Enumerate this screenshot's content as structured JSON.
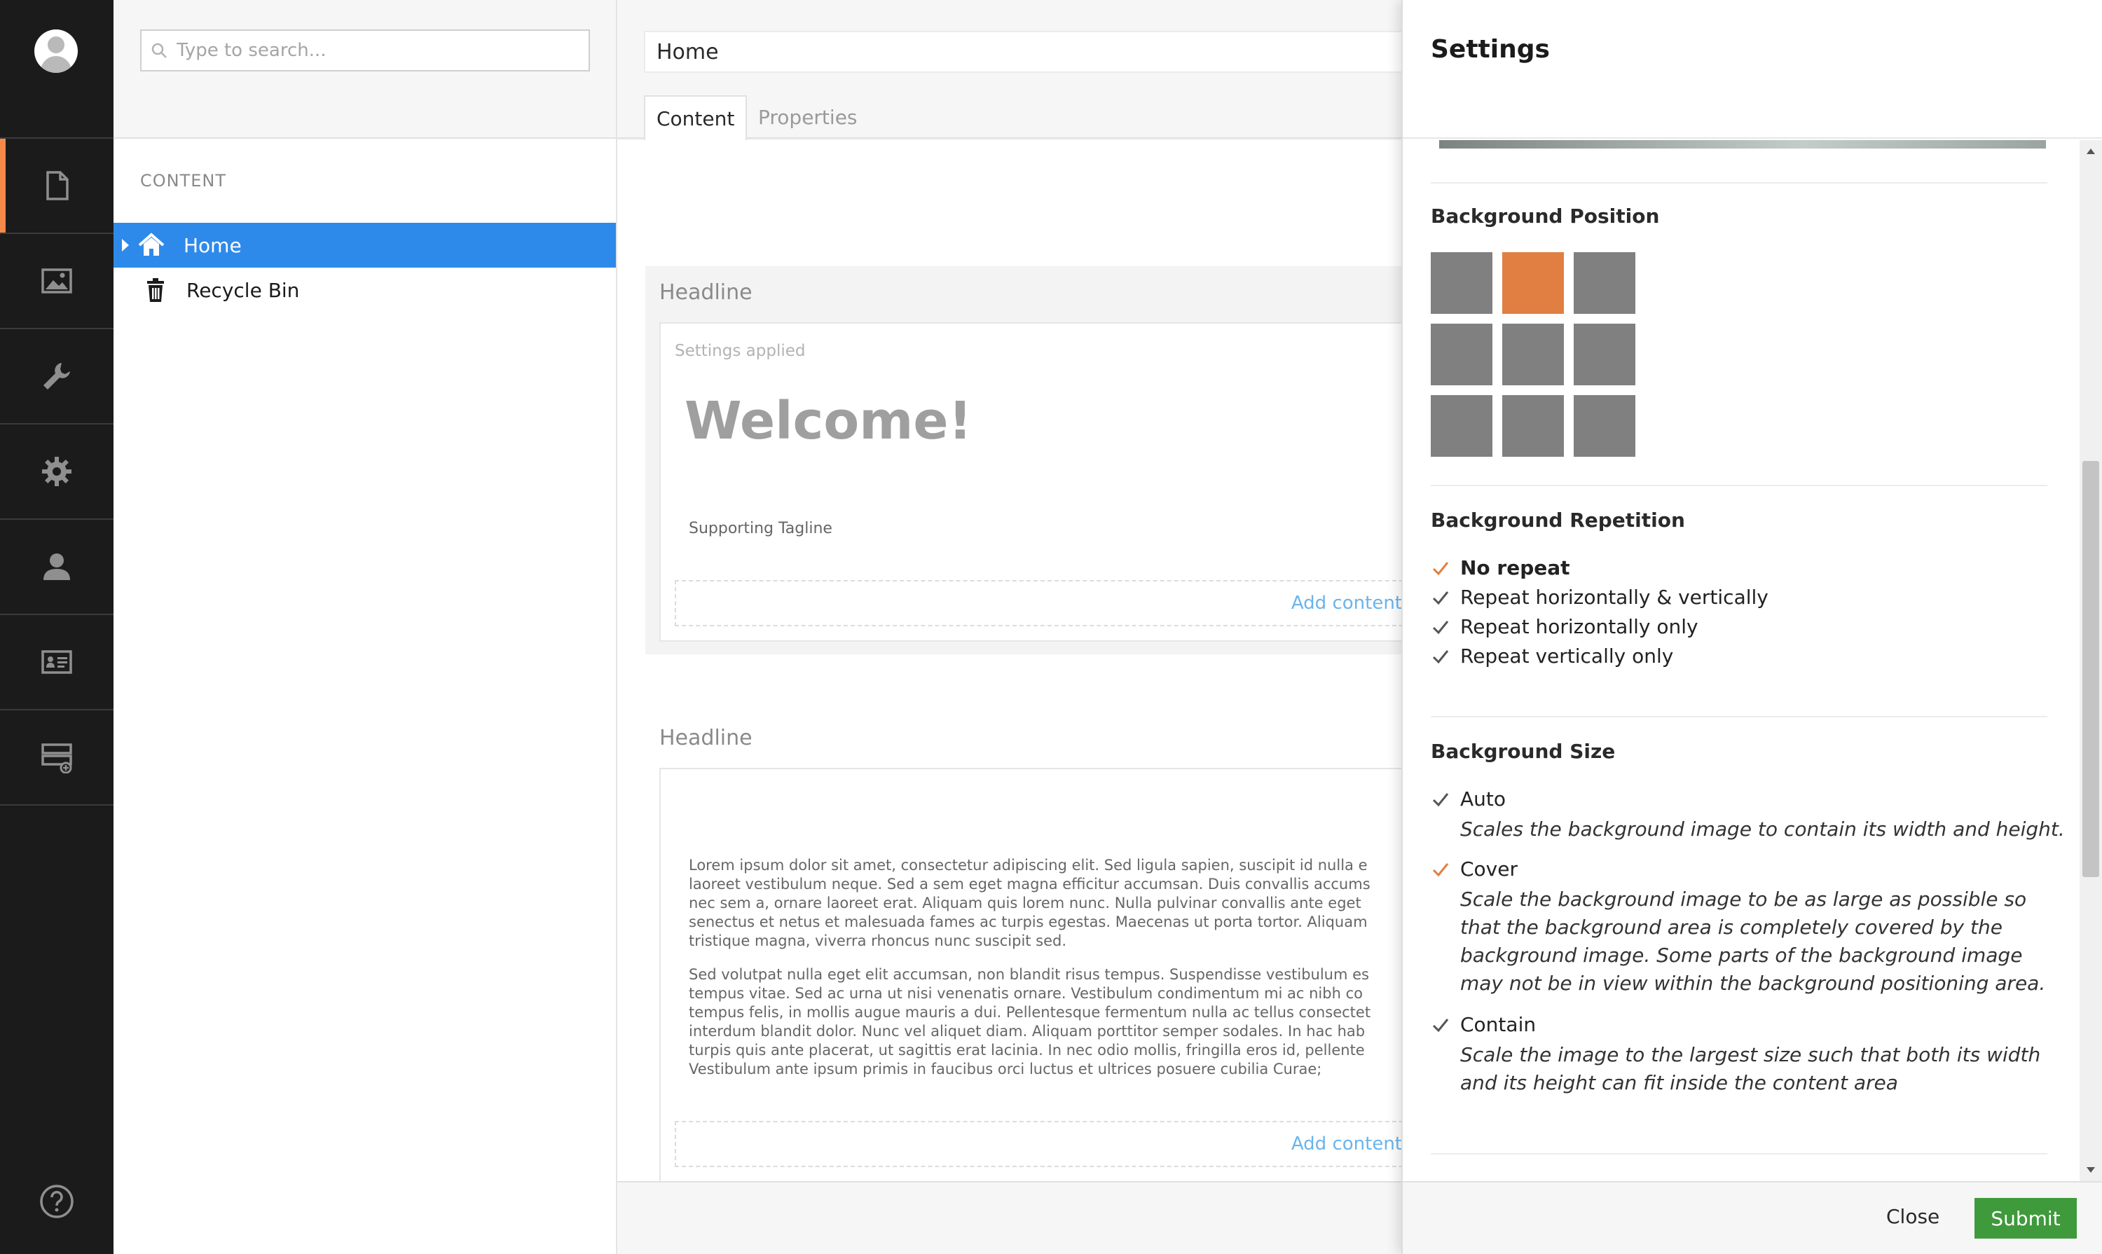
{
  "app": {
    "search": {
      "placeholder": "Type to search..."
    },
    "sections": [
      "content-icon",
      "media-icon",
      "settings-wrench-icon",
      "gear-icon",
      "users-icon",
      "members-icon",
      "forms-icon"
    ],
    "help_icon": "help-icon"
  },
  "tree": {
    "section_title": "CONTENT",
    "nodes": [
      {
        "label": "Home",
        "selected": true,
        "icon": "home-icon"
      },
      {
        "label": "Recycle Bin",
        "selected": false,
        "icon": "trash-icon"
      }
    ]
  },
  "editor": {
    "name": "Home",
    "tabs": [
      {
        "label": "Content",
        "active": true
      },
      {
        "label": "Properties",
        "active": false
      }
    ],
    "blocks": [
      {
        "headline": "Headline",
        "status": "Settings applied",
        "welcome": "Welcome!",
        "tagline": "Supporting Tagline",
        "add_content": "Add content"
      },
      {
        "headline": "Headline",
        "paragraph1": [
          "Lorem ipsum dolor sit amet, consectetur adipiscing elit. Sed ligula sapien, suscipit id nulla e",
          "laoreet vestibulum neque. Sed a sem eget magna efficitur accumsan. Duis convallis accums",
          "nec sem a, ornare laoreet erat. Aliquam quis lorem nunc. Nulla pulvinar convallis ante eget",
          "senectus et netus et malesuada fames ac turpis egestas. Maecenas ut porta tortor. Aliquam",
          "tristique magna, viverra rhoncus nunc suscipit sed."
        ],
        "paragraph2": [
          "Sed volutpat nulla eget elit accumsan, non blandit risus tempus. Suspendisse vestibulum es",
          "tempus vitae. Sed ac urna ut nisi venenatis ornare. Vestibulum condimentum mi ac nibh co",
          "tempus felis, in mollis augue mauris a dui. Pellentesque fermentum nulla ac tellus consectet",
          "interdum blandit dolor. Nunc vel aliquet diam. Aliquam porttitor semper sodales. In hac hab",
          "turpis quis ante placerat, ut sagittis erat lacinia. In nec odio mollis, fringilla eros id, pellente",
          "Vestibulum ante ipsum primis in faucibus orci luctus et ultrices posuere cubilia Curae;"
        ],
        "add_content": "Add content"
      }
    ]
  },
  "settings": {
    "title": "Settings",
    "background_position": {
      "label": "Background Position",
      "selected_index": 1,
      "cells": 9
    },
    "background_repetition": {
      "label": "Background Repetition",
      "options": [
        {
          "label": "No repeat",
          "selected": true
        },
        {
          "label": "Repeat horizontally & vertically",
          "selected": false
        },
        {
          "label": "Repeat horizontally only",
          "selected": false
        },
        {
          "label": "Repeat vertically only",
          "selected": false
        }
      ]
    },
    "background_size": {
      "label": "Background Size",
      "options": [
        {
          "label": "Auto",
          "selected": false,
          "description": "Scales the background image to contain its width and height."
        },
        {
          "label": "Cover",
          "selected": true,
          "description": "Scale the background image to be as large as possible so that the background area is completely covered by the background image. Some parts of the background image may not be in view within the background positioning area."
        },
        {
          "label": "Contain",
          "selected": false,
          "description": "Scale the image to the largest size such that both its width and its height can fit inside the content area"
        }
      ]
    },
    "close_label": "Close",
    "submit_label": "Submit",
    "colors": {
      "accent": "#e07f41",
      "selected_tree": "#2e8aea",
      "submit": "#3e9a3b",
      "rail": "#1b1b1b",
      "check_unselected": "#555555"
    }
  }
}
